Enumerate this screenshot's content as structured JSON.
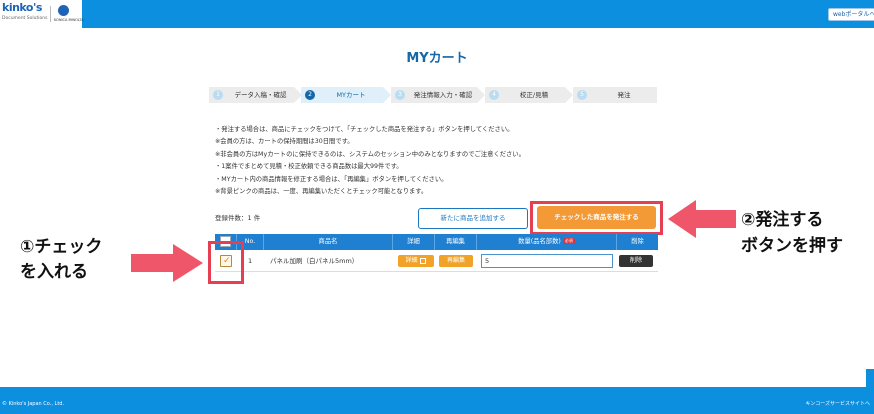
{
  "header": {
    "logo": "kinko's",
    "logo_sub": "Document Solutions",
    "partner_logo_text": "KONICA MINOLTA",
    "portal_button": "webポータルへ"
  },
  "page_title": "MYカート",
  "steps": [
    {
      "num": "1",
      "label": "データ入稿・確認",
      "active": false
    },
    {
      "num": "2",
      "label": "MYカート",
      "active": true
    },
    {
      "num": "3",
      "label": "発注情報入力・確認",
      "active": false
    },
    {
      "num": "4",
      "label": "校正/見積",
      "active": false
    },
    {
      "num": "5",
      "label": "発注",
      "active": false
    }
  ],
  "notes": [
    "・発注する場合は、商品にチェックをつけて、「チェックした商品を発注する」ボタンを押してください。",
    "※会員の方は、カートの保持期間は30日間です。",
    "※非会員の方はMyカートのに保持できるのは、システムのセッション中のみとなりますのでご注意ください。",
    "・1案件でまとめて見積・校正依頼できる商品数は最大99件です。",
    "・MYカート内の商品情報を修正する場合は、「再編集」ボタンを押してください。",
    "※背景ピンクの商品は、一度、再編集いただくとチェック可能となります。"
  ],
  "count": {
    "label": "登録件数：",
    "value": "1",
    "unit": "件"
  },
  "buttons": {
    "add_item": "新たに商品を追加する",
    "order_checked": "チェックした商品を発注する"
  },
  "table": {
    "headers": {
      "no": "No.",
      "name": "商品名",
      "detail": "詳細",
      "reedit": "再編集",
      "qty": "数量(品名部数)",
      "required": "必須",
      "delete": "削除"
    },
    "rows": [
      {
        "checked": true,
        "no": "1",
        "name": "パネル加刷（白パネル5mm）",
        "detail": "詳細",
        "reedit": "再編集",
        "qty": "5",
        "delete": "削除"
      }
    ]
  },
  "annotations": {
    "step1_line1": "①チェック",
    "step1_line2": "を入れる",
    "step2_line1": "②発注する",
    "step2_line2": "ボタンを押す"
  },
  "footer": {
    "copyright": "© Kinko's Japan Co., Ltd.",
    "right_link": "キンコーズサービスサイトへ"
  },
  "colors": {
    "brand_blue": "#0d8fe0",
    "table_header_blue": "#1f7fd1",
    "order_orange": "#f39a37",
    "highlight_red": "#e63e52",
    "annotation_arrow": "#f0566a"
  }
}
